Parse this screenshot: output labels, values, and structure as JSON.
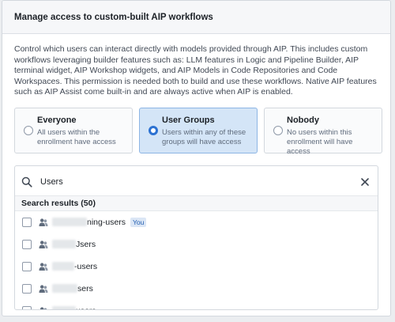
{
  "dialog": {
    "title": "Manage access to custom-built AIP workflows",
    "description": "Control which users can interact directly with models provided through AIP. This includes custom workflows leveraging builder features such as: LLM features in Logic and Pipeline Builder, AIP terminal widget, AIP Workshop widgets, and AIP Models in Code Repositories and Code Workspaces. This permission is needed both to build and use these workflows. Native AIP features such as AIP Assist come built-in and are always active when AIP is enabled."
  },
  "options": [
    {
      "title": "Everyone",
      "desc": "All users within the enrollment have access",
      "selected": false
    },
    {
      "title": "User Groups",
      "desc": "Users within any of these groups will have access",
      "selected": true
    },
    {
      "title": "Nobody",
      "desc": "No users within this enrollment will have access",
      "selected": false
    }
  ],
  "search": {
    "value": "Users",
    "results_label": "Search results (50)"
  },
  "results": [
    {
      "suffix": "ning-users",
      "tag": "You",
      "redact_w": 44
    },
    {
      "suffix": "Jsers",
      "tag": "",
      "redact_w": 30
    },
    {
      "suffix": "-users",
      "tag": "",
      "redact_w": 28
    },
    {
      "suffix": "sers",
      "tag": "",
      "redact_w": 32
    },
    {
      "suffix": "users",
      "tag": "",
      "redact_w": 30
    }
  ],
  "colors": {
    "accent": "#2d72d2",
    "selected_bg": "#d4e5f7",
    "tag_text": "#215db0"
  }
}
